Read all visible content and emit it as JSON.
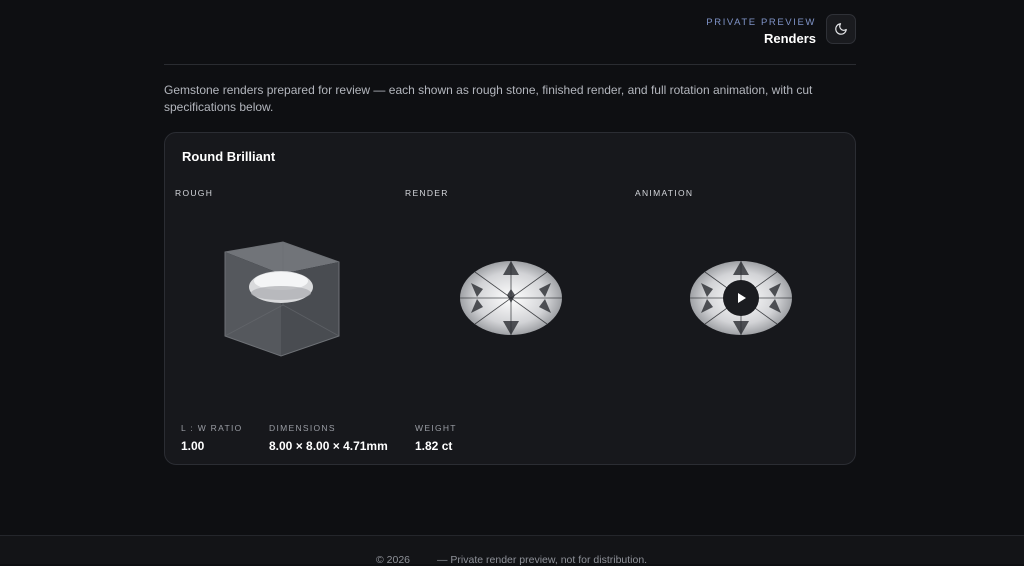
{
  "header": {
    "eyebrow": "PRIVATE PREVIEW",
    "title": "Renders",
    "theme_toggle_icon": "moon-icon"
  },
  "intro": "Gemstone renders prepared for review — each shown as rough stone, finished render, and full rotation animation, with cut specifications below.",
  "card": {
    "title": "Round Brilliant",
    "columns": [
      "ROUGH",
      "RENDER",
      "ANIMATION"
    ],
    "play_icon": "play-icon",
    "specs": [
      {
        "label": "L : W RATIO",
        "value": "1.00"
      },
      {
        "label": "DIMENSIONS",
        "value": "8.00 × 8.00 × 4.71mm"
      },
      {
        "label": "WEIGHT",
        "value": "1.82 ct"
      }
    ]
  },
  "footer": {
    "copyright": "© 2026",
    "note": "— Private render preview, not for distribution."
  },
  "colors": {
    "background": "#0e0f12",
    "card": "#17181c",
    "accent": "#7f93c7"
  }
}
